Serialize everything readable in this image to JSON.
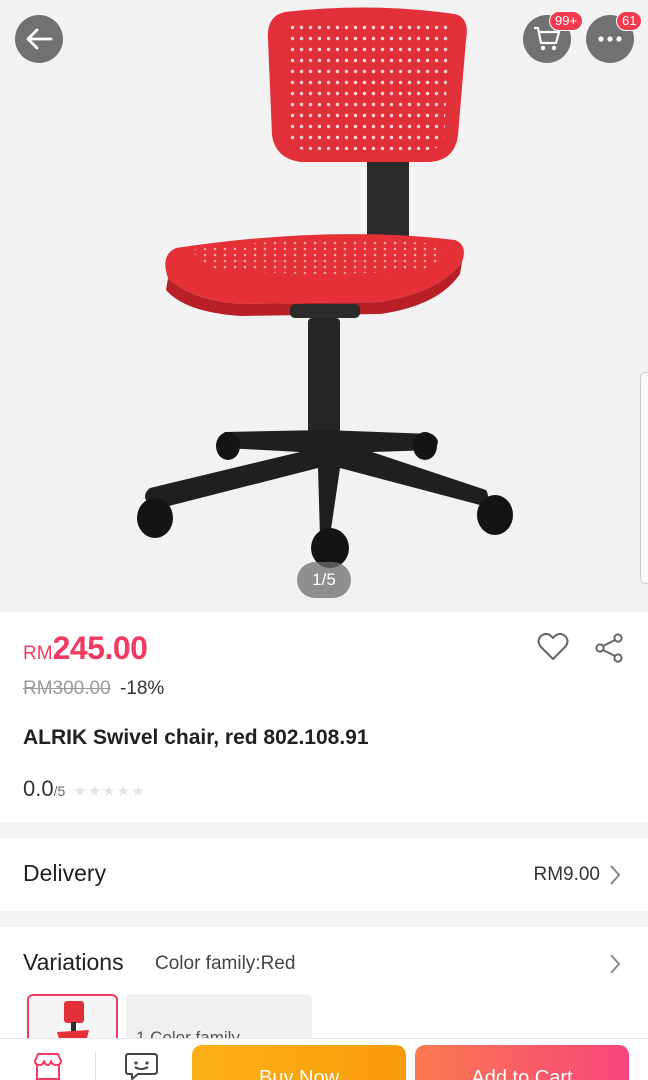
{
  "gallery": {
    "counter": "1/5",
    "cart_badge": "99+",
    "more_badge": "61",
    "colors": {
      "chair_red": "#e8303a",
      "badge": "#f23b4f"
    }
  },
  "product": {
    "currency": "RM",
    "price": "245.00",
    "old_price": "RM300.00",
    "discount": "-18%",
    "title": "ALRIK Swivel chair, red 802.108.91",
    "rating_score": "0.0",
    "rating_max": "/5",
    "rating_stars": 0,
    "accent_color": "#f23b60"
  },
  "delivery": {
    "label": "Delivery",
    "fee": "RM9.00"
  },
  "variations": {
    "label": "Variations",
    "selected": "Color family:Red",
    "option_2_label": "1 Color family"
  },
  "bottom_bar": {
    "buy_now": "Buy Now",
    "add_to_cart": "Add to Cart"
  }
}
